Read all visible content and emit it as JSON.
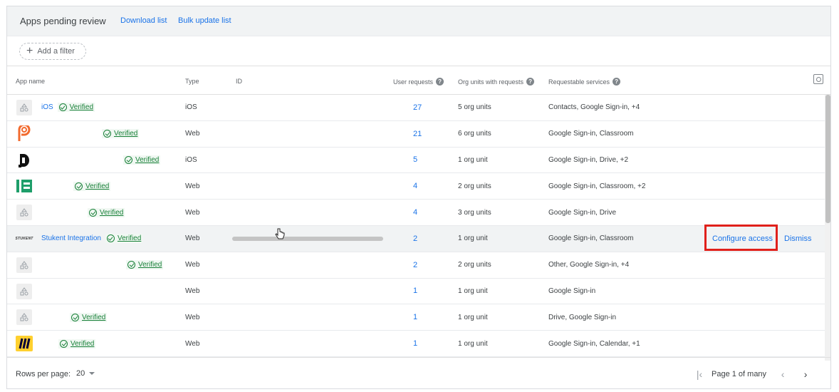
{
  "header": {
    "title": "Apps pending review",
    "download_label": "Download list",
    "bulk_update_label": "Bulk update list"
  },
  "filter": {
    "add_label": "Add a filter"
  },
  "columns": {
    "app_name": "App name",
    "type": "Type",
    "id": "ID",
    "user_requests": "User requests",
    "org_units": "Org units with requests",
    "services": "Requestable services"
  },
  "rows": [
    {
      "name": "iOS",
      "verified": "Verified",
      "type": "iOS",
      "requests": "27",
      "org_units": "5 org units",
      "services": "Contacts, Google Sign-in, +4",
      "icon": "generic-app-icon"
    },
    {
      "name": "",
      "verified": "Verified",
      "type": "Web",
      "requests": "21",
      "org_units": "6 org units",
      "services": "Google Sign-in, Classroom",
      "icon": "orange-p-logo-icon"
    },
    {
      "name": "",
      "verified": "Verified",
      "type": "iOS",
      "requests": "5",
      "org_units": "1 org unit",
      "services": "Google Sign-in, Drive, +2",
      "icon": "black-d-logo-icon"
    },
    {
      "name": "",
      "verified": "Verified",
      "type": "Web",
      "requests": "4",
      "org_units": "2 org units",
      "services": "Google Sign-in, Classroom, +2",
      "icon": "green-logo-icon"
    },
    {
      "name": "",
      "verified": "Verified",
      "type": "Web",
      "requests": "4",
      "org_units": "3 org units",
      "services": "Google Sign-in, Drive",
      "icon": "generic-app-icon"
    },
    {
      "name": "Stukent Integration",
      "verified": "Verified",
      "type": "Web",
      "requests": "2",
      "org_units": "1 org unit",
      "services": "Google Sign-in, Classroom",
      "icon": "stukent-logo-icon",
      "logo_text": "STUKENT"
    },
    {
      "name": "",
      "verified": "Verified",
      "type": "Web",
      "requests": "2",
      "org_units": "2 org units",
      "services": "Other, Google Sign-in, +4",
      "icon": "generic-app-icon"
    },
    {
      "name": "",
      "verified": "",
      "type": "Web",
      "requests": "1",
      "org_units": "1 org unit",
      "services": "Google Sign-in",
      "icon": "generic-app-icon"
    },
    {
      "name": "",
      "verified": "Verified",
      "type": "Web",
      "requests": "1",
      "org_units": "1 org unit",
      "services": "Drive, Google Sign-in",
      "icon": "generic-app-icon"
    },
    {
      "name": "",
      "verified": "Verified",
      "type": "Web",
      "requests": "1",
      "org_units": "1 org unit",
      "services": "Google Sign-in, Calendar, +1",
      "icon": "miro-logo-icon"
    }
  ],
  "row_actions": {
    "configure_label": "Configure access",
    "dismiss_label": "Dismiss"
  },
  "footer": {
    "rows_per_page_label": "Rows per page:",
    "rows_per_page_value": "20",
    "page_text": "Page 1 of many"
  },
  "colors": {
    "link": "#1a73e8",
    "verified": "#188038",
    "highlight": "#e0201b"
  }
}
